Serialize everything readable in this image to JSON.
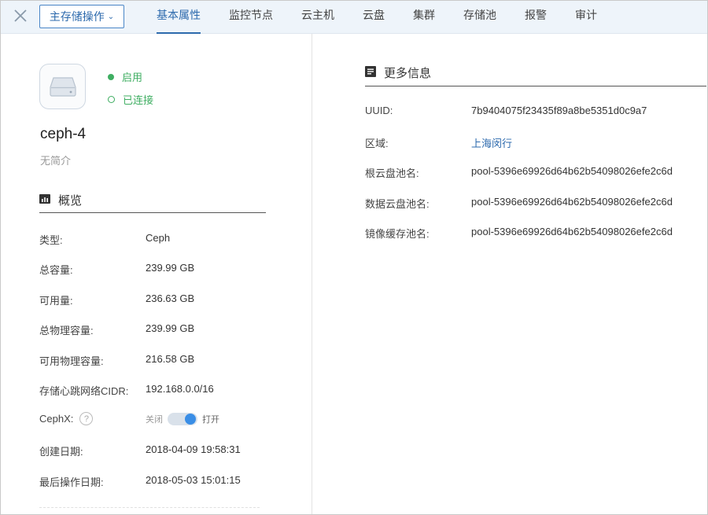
{
  "toolbar": {
    "ops_label": "主存储操作",
    "tabs": [
      "基本属性",
      "监控节点",
      "云主机",
      "云盘",
      "集群",
      "存储池",
      "报警",
      "审计"
    ],
    "active_tab": "基本属性"
  },
  "storage": {
    "status_enabled": "启用",
    "status_connected": "已连接",
    "name": "ceph-4",
    "description": "无简介"
  },
  "overview": {
    "title": "概览",
    "rows": [
      {
        "label": "类型:",
        "value": "Ceph"
      },
      {
        "label": "总容量:",
        "value": "239.99 GB"
      },
      {
        "label": "可用量:",
        "value": "236.63 GB"
      },
      {
        "label": "总物理容量:",
        "value": "239.99 GB"
      },
      {
        "label": "可用物理容量:",
        "value": "216.58 GB"
      },
      {
        "label": "存储心跳网络CIDR:",
        "value": "192.168.0.0/16"
      }
    ],
    "cephx": {
      "label": "CephX:",
      "help": "?",
      "off_label": "关闭",
      "on_label": "打开",
      "state": "on"
    },
    "created": {
      "label": "创建日期:",
      "value": "2018-04-09 19:58:31"
    },
    "last_op": {
      "label": "最后操作日期:",
      "value": "2018-05-03 15:01:15"
    }
  },
  "more_info": {
    "title": "更多信息",
    "rows": [
      {
        "label": "UUID:",
        "value": "7b9404075f23435f89a8be5351d0c9a7"
      },
      {
        "label": "区域:",
        "value": "上海闵行"
      },
      {
        "label": "根云盘池名:",
        "value": "pool-5396e69926d64b62b54098026efe2c6d"
      },
      {
        "label": "数据云盘池名:",
        "value": "pool-5396e69926d64b62b54098026efe2c6d"
      },
      {
        "label": "镜像缓存池名:",
        "value": "pool-5396e69926d64b62b54098026efe2c6d"
      }
    ]
  },
  "colors": {
    "accent": "#2d6aad",
    "status_green": "#3fae62",
    "toggle_on": "#3a8ee6"
  },
  "icons": [
    "close-icon",
    "chevron-down-icon",
    "hard-disk-icon",
    "chart-icon",
    "document-icon",
    "help-icon"
  ]
}
